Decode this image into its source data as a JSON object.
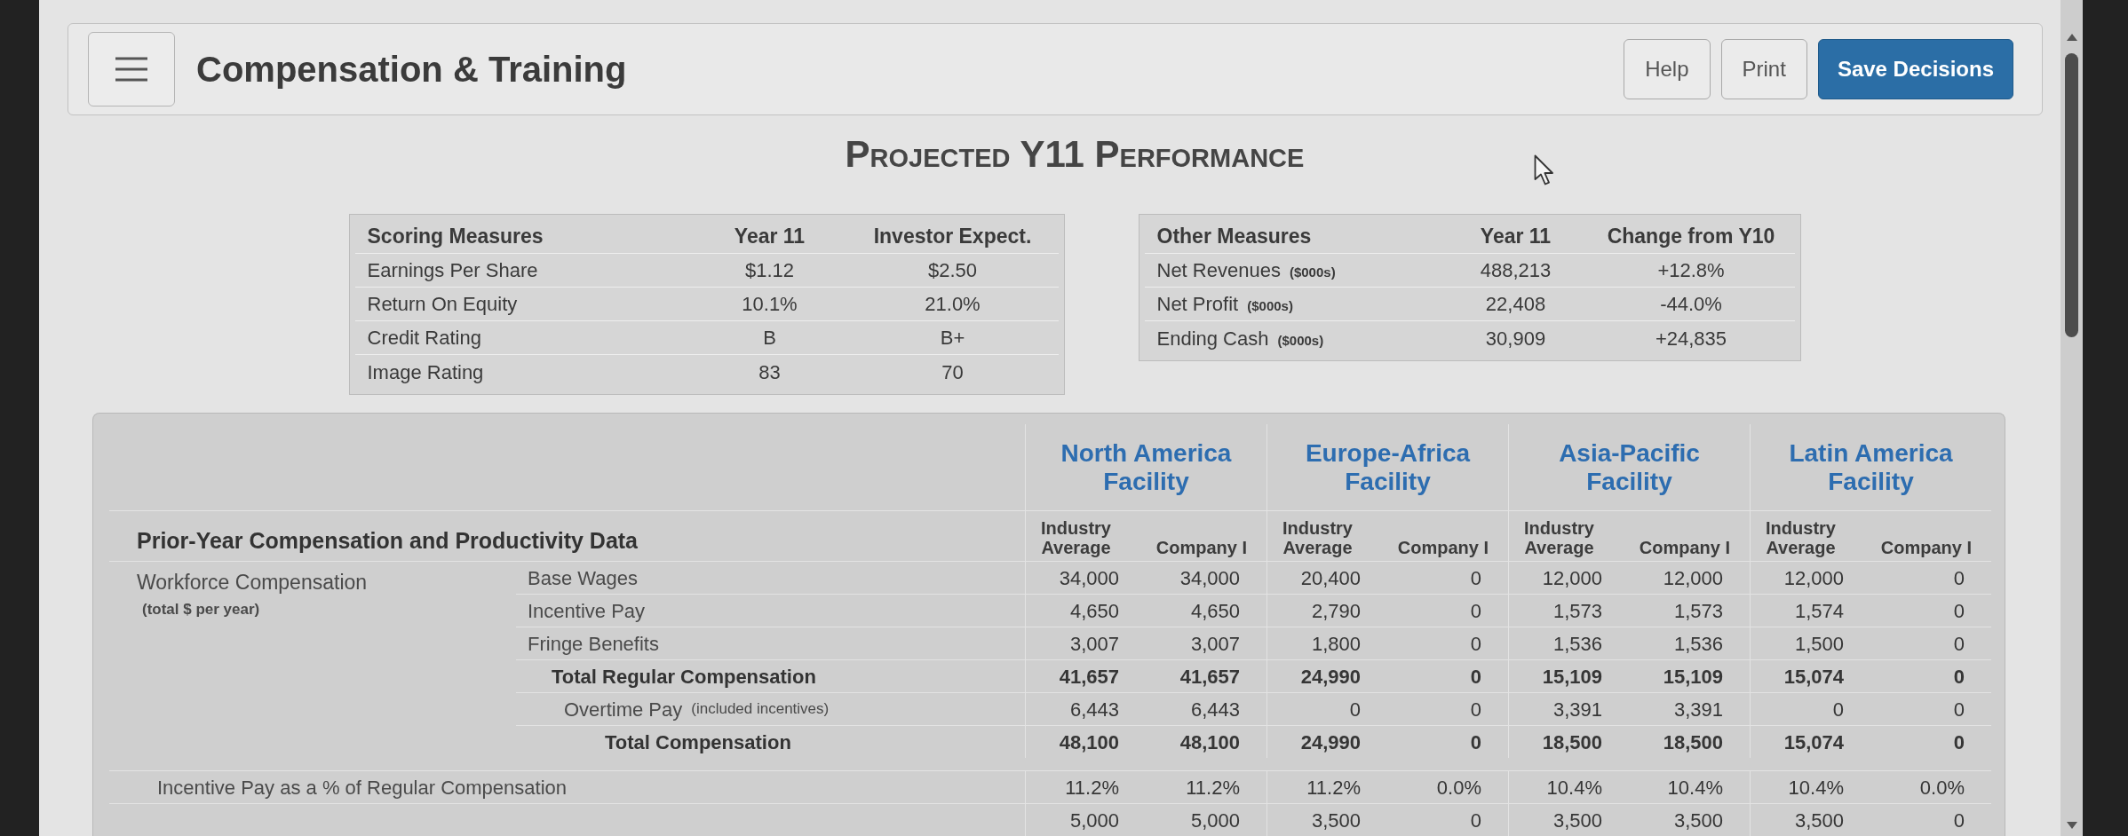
{
  "header": {
    "title": "Compensation & Training",
    "buttons": [
      {
        "label": "Help",
        "kind": "outline"
      },
      {
        "label": "Print",
        "kind": "outline"
      },
      {
        "label": "Save Decisions",
        "kind": "primary"
      }
    ]
  },
  "projection": {
    "title": "Projected Y11 Performance",
    "scoring": {
      "columns": [
        "Scoring Measures",
        "Year 11",
        "Investor Expect."
      ],
      "rows": [
        {
          "label": "Earnings Per Share",
          "values": [
            "$1.12",
            "$2.50"
          ]
        },
        {
          "label": "Return On Equity",
          "values": [
            "10.1%",
            "21.0%"
          ]
        },
        {
          "label": "Credit Rating",
          "values": [
            "B",
            "B+"
          ]
        },
        {
          "label": "Image Rating",
          "values": [
            "83",
            "70"
          ]
        }
      ]
    },
    "other": {
      "columns": [
        "Other Measures",
        "Year 11",
        "Change from Y10"
      ],
      "rows": [
        {
          "label": "Net Revenues",
          "unit": "($000s)",
          "values": [
            "488,213",
            "+12.8%"
          ]
        },
        {
          "label": "Net Profit",
          "unit": "($000s)",
          "values": [
            "22,408",
            "-44.0%"
          ]
        },
        {
          "label": "Ending Cash",
          "unit": "($000s)",
          "values": [
            "30,909",
            "+24,835"
          ]
        }
      ]
    }
  },
  "compensation": {
    "facilities": [
      {
        "name": "North America Facility",
        "columns": [
          "Industry Average",
          "Company I"
        ]
      },
      {
        "name": "Europe-Africa Facility",
        "columns": [
          "Industry Average",
          "Company I"
        ]
      },
      {
        "name": "Asia-Pacific Facility",
        "columns": [
          "Industry Average",
          "Company I"
        ]
      },
      {
        "name": "Latin America Facility",
        "columns": [
          "Industry Average",
          "Company I"
        ]
      }
    ],
    "title": "Prior-Year Compensation and Productivity Data",
    "group": {
      "label": "Workforce Compensation",
      "note": "(total $ per year)",
      "rows": [
        {
          "label": "Base Wages",
          "kind": "item",
          "values": [
            "34,000",
            "34,000",
            "20,400",
            "0",
            "12,000",
            "12,000",
            "12,000",
            "0"
          ]
        },
        {
          "label": "Incentive Pay",
          "kind": "item",
          "values": [
            "4,650",
            "4,650",
            "2,790",
            "0",
            "1,573",
            "1,573",
            "1,574",
            "0"
          ]
        },
        {
          "label": "Fringe Benefits",
          "kind": "item",
          "values": [
            "3,007",
            "3,007",
            "1,800",
            "0",
            "1,536",
            "1,536",
            "1,500",
            "0"
          ]
        },
        {
          "label": "Total Regular Compensation",
          "kind": "subtotal",
          "values": [
            "41,657",
            "41,657",
            "24,990",
            "0",
            "15,109",
            "15,109",
            "15,074",
            "0"
          ]
        },
        {
          "label": "Overtime Pay",
          "note": "(included incentives)",
          "kind": "extra",
          "values": [
            "6,443",
            "6,443",
            "0",
            "0",
            "3,391",
            "3,391",
            "0",
            "0"
          ]
        },
        {
          "label": "Total Compensation",
          "kind": "total",
          "values": [
            "48,100",
            "48,100",
            "24,990",
            "0",
            "18,500",
            "18,500",
            "15,074",
            "0"
          ]
        }
      ]
    },
    "rows": [
      {
        "label": "Incentive Pay as a % of Regular Compensation",
        "values": [
          "11.2%",
          "11.2%",
          "11.2%",
          "0.0%",
          "10.4%",
          "10.4%",
          "10.4%",
          "0.0%"
        ]
      },
      {
        "values": [
          "5,000",
          "5,000",
          "3,500",
          "0",
          "3,500",
          "3,500",
          "3,500",
          "0"
        ]
      }
    ]
  }
}
